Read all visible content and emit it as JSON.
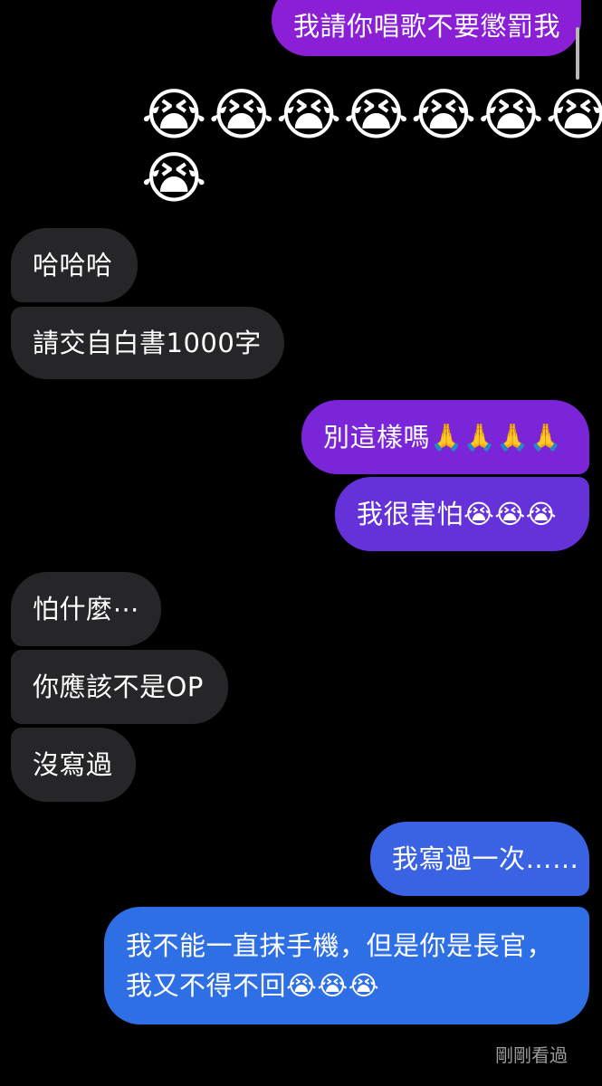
{
  "messages": [
    {
      "text": "我請你唱歌不要懲罰我"
    },
    {
      "text": "😭😭😭😭😭😭😭"
    },
    {
      "text": "😭"
    },
    {
      "text": "哈哈哈"
    },
    {
      "text": "請交自白書1000字"
    },
    {
      "text": "別這樣嗎🙏🙏🙏🙏"
    },
    {
      "text": "我很害怕😭😭😭"
    },
    {
      "text": "怕什麼⋯"
    },
    {
      "text": "你應該不是OP"
    },
    {
      "text": "沒寫過"
    },
    {
      "text": "我寫過一次……"
    },
    {
      "text": "我不能一直抹手機，但是你是長官，"
    },
    {
      "text": "我又不得不回😭😭😭"
    }
  ],
  "status": {
    "seen_label": "剛剛看過"
  },
  "colors": {
    "background": "#000000",
    "incoming": "#262628",
    "outgoing_purple": "#8a1fd6",
    "outgoing_violet": "#6c2fd8",
    "outgoing_blue": "#2e6fe6",
    "seen_text": "#9a9a9a"
  }
}
